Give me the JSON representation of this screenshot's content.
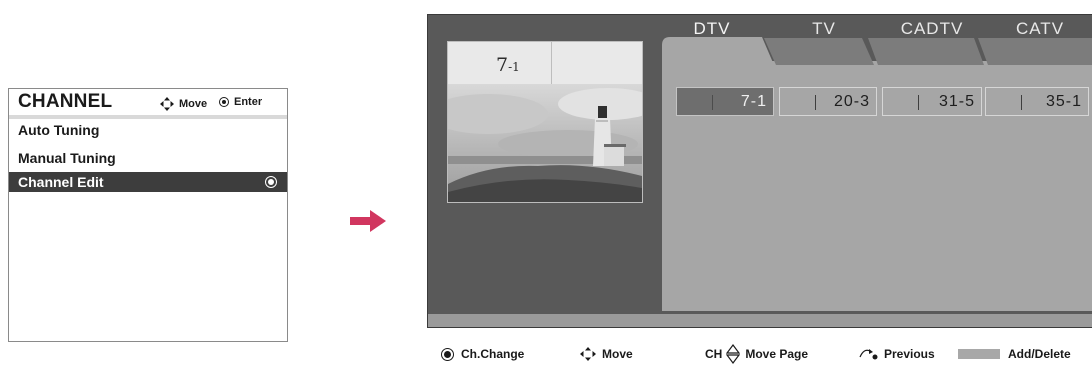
{
  "menu": {
    "title": "CHANNEL",
    "hint_move": "Move",
    "hint_enter": "Enter",
    "items": [
      {
        "label": "Auto Tuning",
        "selected": false
      },
      {
        "label": "Manual Tuning",
        "selected": false
      },
      {
        "label": "Channel Edit",
        "selected": true
      }
    ]
  },
  "screen": {
    "preview_channel_main": "7",
    "preview_channel_sub": "-1",
    "tabs": [
      {
        "label": "DTV",
        "active": true
      },
      {
        "label": "TV",
        "active": false
      },
      {
        "label": "CADTV",
        "active": false
      },
      {
        "label": "CATV",
        "active": false
      }
    ],
    "channels": [
      {
        "number": "7-1",
        "active": true
      },
      {
        "number": "20-3",
        "active": false
      },
      {
        "number": "31-5",
        "active": false
      },
      {
        "number": "35-1",
        "active": false
      }
    ]
  },
  "legend": {
    "ch_change": "Ch.Change",
    "move": "Move",
    "ch_prefix": "CH",
    "move_page": "Move Page",
    "previous": "Previous",
    "add_delete": "Add/Delete"
  },
  "colors": {
    "arrow": "#d1365f",
    "screen_bg": "#595959",
    "panel_bg": "#a6a6a6",
    "selected_item": "#3d3d3d"
  }
}
